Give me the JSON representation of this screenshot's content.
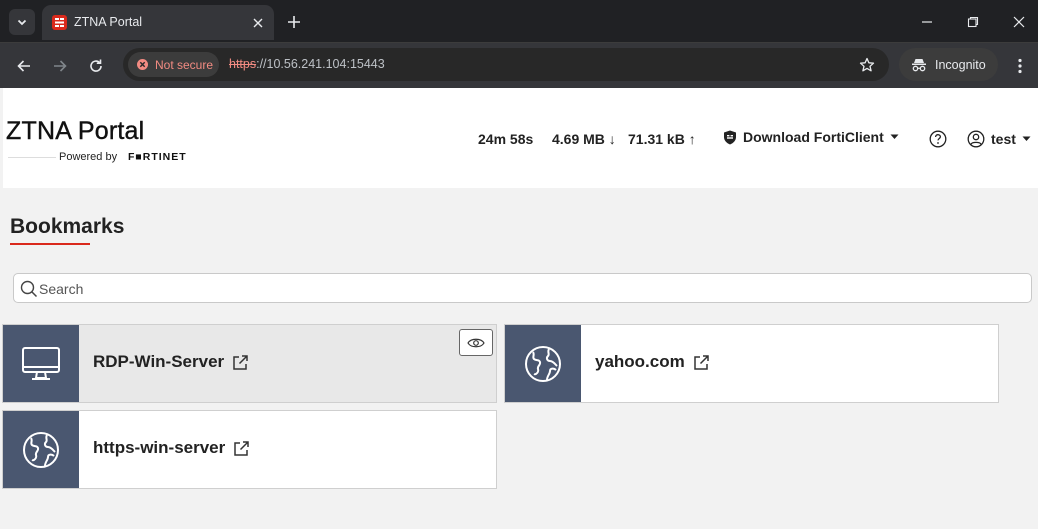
{
  "browser": {
    "tab_title": "ZTNA Portal",
    "secure_label": "Not secure",
    "url_scheme": "https",
    "url_rest": "://10.56.241.104:15443",
    "incognito_label": "Incognito"
  },
  "header": {
    "title": "ZTNA Portal",
    "powered_by": "Powered by",
    "vendor": "F■RTINET",
    "session_time": "24m 58s",
    "download": "4.69 MB ↓",
    "upload": "71.31 kB ↑",
    "download_button": "Download FortiClient",
    "user": "test"
  },
  "bookmarks": {
    "title": "Bookmarks",
    "search_placeholder": "Search",
    "items": [
      {
        "label": "RDP-Win-Server",
        "icon": "monitor-icon"
      },
      {
        "label": "yahoo.com",
        "icon": "globe-icon"
      },
      {
        "label": "https-win-server",
        "icon": "globe-icon"
      }
    ]
  },
  "colors": {
    "accent": "#da291c",
    "thumb": "#4a5770",
    "chrome_dark": "#202124"
  }
}
